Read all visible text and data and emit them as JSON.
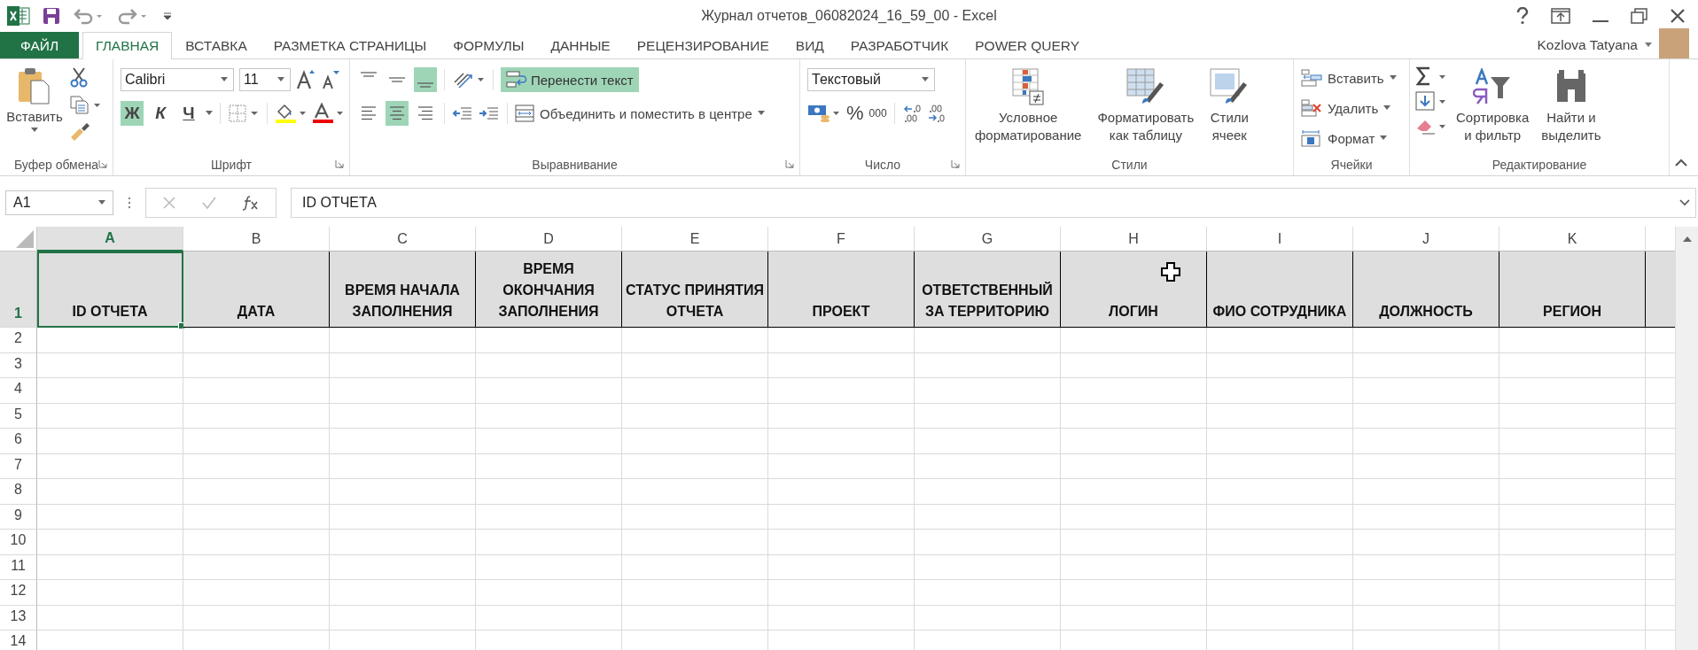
{
  "window": {
    "title": "Журнал отчетов_06082024_16_59_00 - Excel"
  },
  "tabs": [
    {
      "label": "ФАЙЛ",
      "kind": "file",
      "selected": false
    },
    {
      "label": "ГЛАВНАЯ",
      "kind": "tab",
      "selected": true
    },
    {
      "label": "ВСТАВКА",
      "kind": "tab",
      "selected": false
    },
    {
      "label": "РАЗМЕТКА СТРАНИЦЫ",
      "kind": "tab",
      "selected": false
    },
    {
      "label": "ФОРМУЛЫ",
      "kind": "tab",
      "selected": false
    },
    {
      "label": "ДАННЫЕ",
      "kind": "tab",
      "selected": false
    },
    {
      "label": "РЕЦЕНЗИРОВАНИЕ",
      "kind": "tab",
      "selected": false
    },
    {
      "label": "ВИД",
      "kind": "tab",
      "selected": false
    },
    {
      "label": "РАЗРАБОТЧИК",
      "kind": "tab",
      "selected": false
    },
    {
      "label": "POWER QUERY",
      "kind": "tab",
      "selected": false
    }
  ],
  "user": {
    "name": "Kozlova Tatyana"
  },
  "ribbon": {
    "clipboard": {
      "label": "Буфер обмена",
      "paste": "Вставить"
    },
    "font": {
      "label": "Шрифт",
      "font_name": "Calibri",
      "font_size": "11",
      "styles": [
        {
          "label": "Ж",
          "kind": "bold",
          "on": true
        },
        {
          "label": "К",
          "kind": "italic",
          "on": false
        },
        {
          "label": "Ч",
          "kind": "underline",
          "on": false
        }
      ]
    },
    "alignment": {
      "label": "Выравнивание",
      "vertical": [
        {
          "kind": "top",
          "on": false
        },
        {
          "kind": "middle",
          "on": false
        },
        {
          "kind": "bottom",
          "on": true
        }
      ],
      "horizontal": [
        {
          "kind": "left",
          "on": false
        },
        {
          "kind": "center",
          "on": true
        },
        {
          "kind": "right",
          "on": false
        }
      ],
      "wrap_text": {
        "label": "Перенести текст",
        "on": true
      },
      "merge": "Объединить и поместить в центре"
    },
    "number": {
      "label": "Число",
      "format": "Текстовый",
      "percent": "%",
      "thousands": "000"
    },
    "styles": {
      "label": "Стили",
      "buttons": [
        {
          "kind": "conditional",
          "label": "Условное\nформатирование"
        },
        {
          "kind": "table",
          "label": "Форматировать\nкак таблицу"
        },
        {
          "kind": "cellstyles",
          "label": "Стили\nячеек"
        }
      ]
    },
    "cells": {
      "label": "Ячейки",
      "items": [
        {
          "kind": "insert",
          "label": "Вставить"
        },
        {
          "kind": "delete",
          "label": "Удалить"
        },
        {
          "kind": "format",
          "label": "Формат"
        }
      ]
    },
    "editing": {
      "label": "Редактирование",
      "buttons": [
        {
          "kind": "sort",
          "label": "Сортировка\nи фильтр"
        },
        {
          "kind": "find",
          "label": "Найти и\nвыделить"
        }
      ]
    }
  },
  "formula_bar": {
    "name_box": "A1",
    "content": "ID ОТЧЕТА"
  },
  "sheet": {
    "columns": [
      {
        "letter": "A",
        "selected": true
      },
      {
        "letter": "B",
        "selected": false
      },
      {
        "letter": "C",
        "selected": false
      },
      {
        "letter": "D",
        "selected": false
      },
      {
        "letter": "E",
        "selected": false
      },
      {
        "letter": "F",
        "selected": false
      },
      {
        "letter": "G",
        "selected": false
      },
      {
        "letter": "H",
        "selected": false
      },
      {
        "letter": "I",
        "selected": false
      },
      {
        "letter": "J",
        "selected": false
      },
      {
        "letter": "K",
        "selected": false
      }
    ],
    "rows": [
      {
        "number": "1",
        "selected": true
      },
      {
        "number": "2",
        "selected": false
      },
      {
        "number": "3",
        "selected": false
      },
      {
        "number": "4",
        "selected": false
      },
      {
        "number": "5",
        "selected": false
      },
      {
        "number": "6",
        "selected": false
      },
      {
        "number": "7",
        "selected": false
      },
      {
        "number": "8",
        "selected": false
      },
      {
        "number": "9",
        "selected": false
      },
      {
        "number": "10",
        "selected": false
      },
      {
        "number": "11",
        "selected": false
      },
      {
        "number": "12",
        "selected": false
      },
      {
        "number": "13",
        "selected": false
      },
      {
        "number": "14",
        "selected": false
      }
    ],
    "header_cells": [
      {
        "text": "ID ОТЧЕТА",
        "selected": true
      },
      {
        "text": "ДАТА",
        "selected": false
      },
      {
        "text": "ВРЕМЯ НАЧАЛА ЗАПОЛНЕНИЯ",
        "selected": false
      },
      {
        "text": "ВРЕМЯ ОКОНЧАНИЯ ЗАПОЛНЕНИЯ",
        "selected": false
      },
      {
        "text": "СТАТУС ПРИНЯТИЯ ОТЧЕТА",
        "selected": false
      },
      {
        "text": "ПРОЕКТ",
        "selected": false
      },
      {
        "text": "ОТВЕТСТВЕННЫЙ ЗА ТЕРРИТОРИЮ",
        "selected": false
      },
      {
        "text": "ЛОГИН",
        "selected": false
      },
      {
        "text": "ФИО СОТРУДНИКА",
        "selected": false
      },
      {
        "text": "ДОЛЖНОСТЬ",
        "selected": false
      },
      {
        "text": "РЕГИОН",
        "selected": false
      }
    ]
  }
}
